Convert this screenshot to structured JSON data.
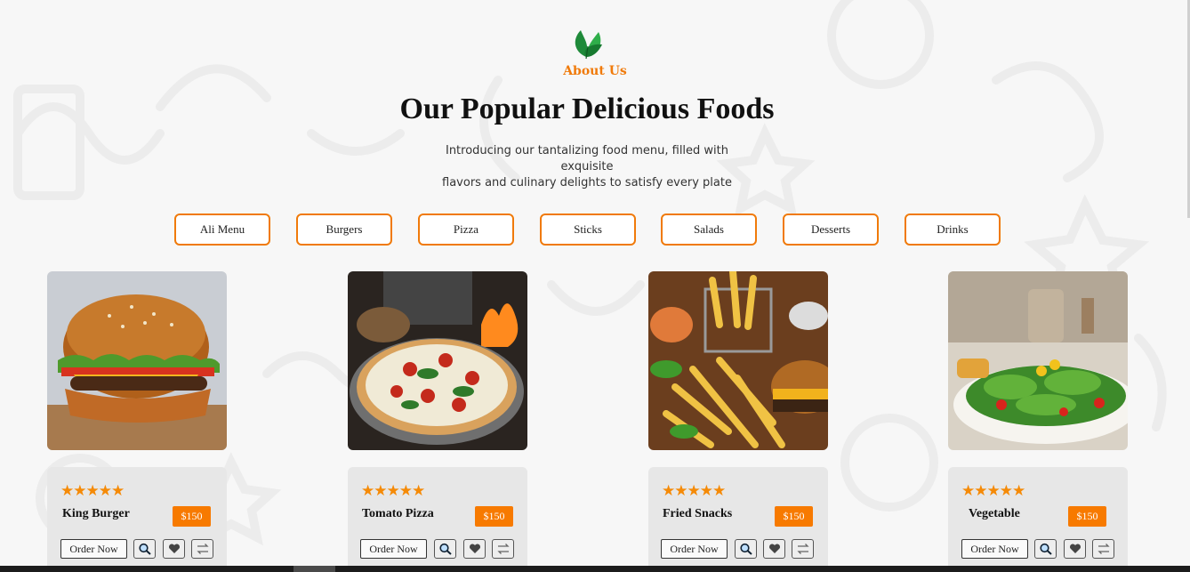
{
  "section": {
    "eyebrow": "About Us",
    "title": "Our Popular Delicious Foods",
    "intro_line1": "Introducing our tantalizing food menu, filled with exquisite",
    "intro_line2": "flavors and culinary delights to satisfy every plate"
  },
  "tabs": [
    "Ali Menu",
    "Burgers",
    "Pizza",
    "Sticks",
    "Salads",
    "Desserts",
    "Drinks"
  ],
  "products": [
    {
      "name": "King Burger",
      "price": "$150",
      "rating": 5,
      "order_label": "Order Now"
    },
    {
      "name": "Tomato Pizza",
      "price": "$150",
      "rating": 5,
      "order_label": "Order Now"
    },
    {
      "name": "Fried Snacks",
      "price": "$150",
      "rating": 5,
      "order_label": "Order Now"
    },
    {
      "name": "Vegetable",
      "price": "$150",
      "rating": 5,
      "order_label": "Order Now"
    }
  ],
  "stars_text": "★★★★★",
  "colors": {
    "accent": "#f07a0a",
    "price_bg": "#f77a00",
    "card_bg": "#e7e7e7"
  },
  "icons": [
    "leaf-icon",
    "search-icon",
    "heart-icon",
    "compare-icon"
  ]
}
